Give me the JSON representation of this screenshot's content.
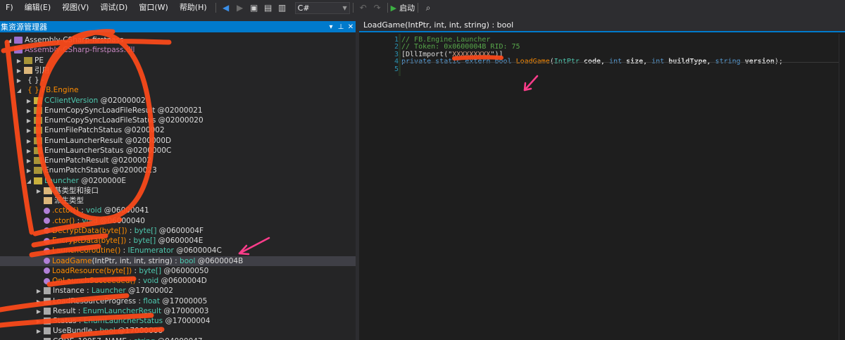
{
  "menu": {
    "items": [
      "F)",
      "编辑(E)",
      "视图(V)",
      "调试(D)",
      "窗口(W)",
      "帮助(H)"
    ]
  },
  "toolbar": {
    "language": "C#",
    "start_label": "启动"
  },
  "explorer": {
    "title": "集资源管理器",
    "rows": [
      {
        "depth": 0,
        "twisty": "◢",
        "icon": "assembly",
        "name": "Assembly-CSharp-firstpass",
        "suffix": ""
      },
      {
        "depth": 0,
        "twisty": "",
        "icon": "assembly",
        "name": "Assembly-CSharp-firstpass.dll",
        "suffix": "",
        "purple": true
      },
      {
        "depth": 1,
        "twisty": "▶",
        "icon": "pe",
        "name": "PE",
        "suffix": ""
      },
      {
        "depth": 1,
        "twisty": "▶",
        "icon": "ref",
        "name": "引用",
        "suffix": ""
      },
      {
        "depth": 1,
        "twisty": "▶",
        "icon": "ns",
        "name": "{ } -",
        "suffix": ""
      },
      {
        "depth": 1,
        "twisty": "◢",
        "icon": "ns",
        "name": "{ } FB.Engine",
        "suffix": "",
        "orange": true
      },
      {
        "depth": 2,
        "twisty": "▶",
        "icon": "class",
        "name": "CClientVersion",
        "suffix": " @02000002",
        "green": true
      },
      {
        "depth": 2,
        "twisty": "▶",
        "icon": "enum",
        "name": "EnumCopySyncLoadFileResult",
        "suffix": " @02000021"
      },
      {
        "depth": 2,
        "twisty": "▶",
        "icon": "enum",
        "name": "EnumCopySyncLoadFileStatus",
        "suffix": " @02000020"
      },
      {
        "depth": 2,
        "twisty": "▶",
        "icon": "enum",
        "name": "EnumFilePatchStatus",
        "suffix": " @0200002"
      },
      {
        "depth": 2,
        "twisty": "▶",
        "icon": "enum",
        "name": "EnumLauncherResult",
        "suffix": " @0200000D"
      },
      {
        "depth": 2,
        "twisty": "▶",
        "icon": "enum",
        "name": "EnumLauncherStatus",
        "suffix": " @0200000C"
      },
      {
        "depth": 2,
        "twisty": "▶",
        "icon": "enum",
        "name": "EnumPatchResult",
        "suffix": " @0200002"
      },
      {
        "depth": 2,
        "twisty": "▶",
        "icon": "enum",
        "name": "EnumPatchStatus",
        "suffix": " @02000023"
      },
      {
        "depth": 2,
        "twisty": "◢",
        "icon": "class",
        "name": "Launcher",
        "suffix": " @0200000E",
        "green": true
      },
      {
        "depth": 3,
        "twisty": "▶",
        "icon": "folder",
        "name": "基类型和接口",
        "suffix": ""
      },
      {
        "depth": 3,
        "twisty": "",
        "icon": "folder",
        "name": "派生类型",
        "suffix": ""
      },
      {
        "depth": 3,
        "twisty": "",
        "icon": "method",
        "name": ".cctor()",
        "ret": "void",
        "suffix": " @06000041",
        "orange": true
      },
      {
        "depth": 3,
        "twisty": "",
        "icon": "method",
        "name": ".ctor()",
        "ret": "void",
        "suffix": " @06000040",
        "orange": true
      },
      {
        "depth": 3,
        "twisty": "",
        "icon": "method",
        "name": "DecryptData(byte[])",
        "ret": "byte[]",
        "suffix": " @0600004F",
        "orange": true
      },
      {
        "depth": 3,
        "twisty": "",
        "icon": "method",
        "name": "EncryptData(byte[])",
        "ret": "byte[]",
        "suffix": " @0600004E",
        "orange": true
      },
      {
        "depth": 3,
        "twisty": "",
        "icon": "method",
        "name": "LaunchCoroutine()",
        "ret": "IEnumerator",
        "suffix": " @0600004C",
        "orange": true
      },
      {
        "depth": 3,
        "twisty": "",
        "icon": "method",
        "name": "LoadGame",
        "args": "(IntPtr, int, int, string)",
        "ret": "bool",
        "suffix": " @0600004B",
        "orange": true,
        "selected": true
      },
      {
        "depth": 3,
        "twisty": "",
        "icon": "method",
        "name": "LoadResource(byte[])",
        "ret": "byte[]",
        "suffix": " @06000050",
        "orange": true
      },
      {
        "depth": 3,
        "twisty": "",
        "icon": "method",
        "name": "OnLaunchSucceeded()",
        "ret": "void",
        "suffix": " @0600004D",
        "orange": true
      },
      {
        "depth": 3,
        "twisty": "▶",
        "icon": "prop",
        "name": "Instance",
        "ret": "Launcher",
        "suffix": " @17000002"
      },
      {
        "depth": 3,
        "twisty": "▶",
        "icon": "prop",
        "name": "LoadResourceProgress",
        "ret": "float",
        "suffix": " @17000005"
      },
      {
        "depth": 3,
        "twisty": "▶",
        "icon": "prop",
        "name": "Result",
        "ret": "EnumLauncherResult",
        "suffix": " @17000003"
      },
      {
        "depth": 3,
        "twisty": "▶",
        "icon": "prop",
        "name": "Status",
        "ret": "EnumLauncherStatus",
        "suffix": " @17000004"
      },
      {
        "depth": 3,
        "twisty": "▶",
        "icon": "prop",
        "name": "UseBundle",
        "ret": "bool",
        "suffix": " @17000006"
      },
      {
        "depth": 3,
        "twisty": "",
        "icon": "prop",
        "name": "CODE_10057_NAME",
        "ret": "string",
        "suffix": " @04000047"
      }
    ]
  },
  "editor": {
    "tab_label": "LoadGame(IntPtr, int, int, string) : bool",
    "line_numbers": [
      "1",
      "2",
      "3",
      "4",
      "5"
    ],
    "lines": [
      {
        "parts": [
          {
            "t": "// FB.Engine.Launcher",
            "c": "comment"
          }
        ]
      },
      {
        "parts": [
          {
            "t": "// Token: 0x0600004B RID: 75",
            "c": "comment"
          }
        ]
      },
      {
        "parts": [
          {
            "t": "[DllImport(\"",
            "c": "plain"
          },
          {
            "t": "XXXXXXXXX",
            "c": "str"
          },
          {
            "t": "\")]",
            "c": "plain"
          }
        ]
      },
      {
        "parts": [
          {
            "t": "private static extern bool ",
            "c": "kw"
          },
          {
            "t": "LoadGame",
            "c": "fn"
          },
          {
            "t": "(",
            "c": "plain"
          },
          {
            "t": "IntPtr",
            "c": "type"
          },
          {
            "t": " code, ",
            "c": "bold"
          },
          {
            "t": "int",
            "c": "kw"
          },
          {
            "t": " size, ",
            "c": "bold"
          },
          {
            "t": "int",
            "c": "kw"
          },
          {
            "t": " buildType, ",
            "c": "bold"
          },
          {
            "t": "string",
            "c": "kw"
          },
          {
            "t": " version",
            "c": "bold"
          },
          {
            "t": ");",
            "c": "plain"
          }
        ]
      },
      {
        "parts": [
          {
            "t": "",
            "c": "plain"
          }
        ]
      }
    ]
  },
  "colors": {
    "accent": "#007acc",
    "scribble": "#ff4a1a",
    "arrow": "#ff3d8b"
  }
}
